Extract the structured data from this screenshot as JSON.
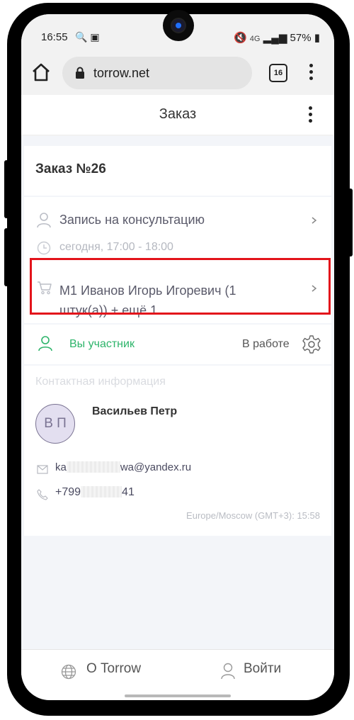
{
  "status_bar": {
    "time": "16:55",
    "left_icons": "🔍 ▣",
    "network": "4G",
    "battery": "57%"
  },
  "browser": {
    "url": "torrow.net",
    "tab_count": "16"
  },
  "app": {
    "title": "Заказ"
  },
  "order": {
    "title": "Заказ №26",
    "service": "Запись на консультацию",
    "time": "сегодня, 17:00 - 18:00",
    "items": "М1 Иванов Игорь Игоревич (1 штук(а)) + ещё 1",
    "participant": "Вы участник",
    "status": "В работе"
  },
  "contact": {
    "section_label": "Контактная информация",
    "initials": "В П",
    "name": "Васильев Петр",
    "email_start": "ka",
    "email_end": "wa@yandex.ru",
    "phone_start": "+799",
    "phone_end": "41",
    "timezone": "Europe/Moscow (GMT+3): 15:58"
  },
  "bottom": {
    "about": "О Torrow",
    "login": "Войти"
  },
  "colors": {
    "accent_green": "#2db46a",
    "highlight_red": "#e3141b"
  },
  "icons": [
    "search-icon",
    "screen-icon",
    "home-icon",
    "lock-icon",
    "menu-dots-icon",
    "person-icon",
    "clock-icon",
    "cart-icon",
    "chevron-right-icon",
    "gear-icon",
    "mail-icon",
    "phone-icon",
    "globe-icon"
  ]
}
